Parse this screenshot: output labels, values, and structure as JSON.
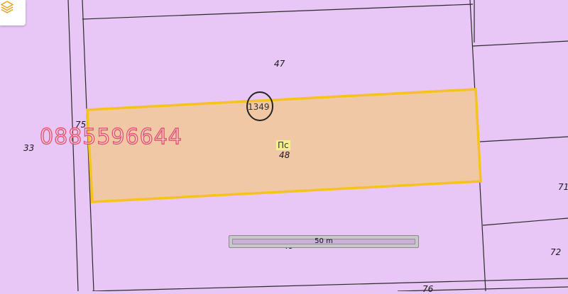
{
  "map": {
    "layers_icon": "layers-icon",
    "parcel_numbers": {
      "p47": "47",
      "p48": "48",
      "p49": "49",
      "p33": "33",
      "p75": "75",
      "p71": "71",
      "p72": "72",
      "p76": "76"
    },
    "building_number": "1349",
    "land_use_code": "Пс",
    "watermark_phone": "0885596644",
    "scale_label": "50 m",
    "colors": {
      "background": "#e8c6f6",
      "selected_fill": "#f1c8a6",
      "selected_outline": "#f5c31c",
      "boundary_line": "#2b2b2b"
    }
  }
}
